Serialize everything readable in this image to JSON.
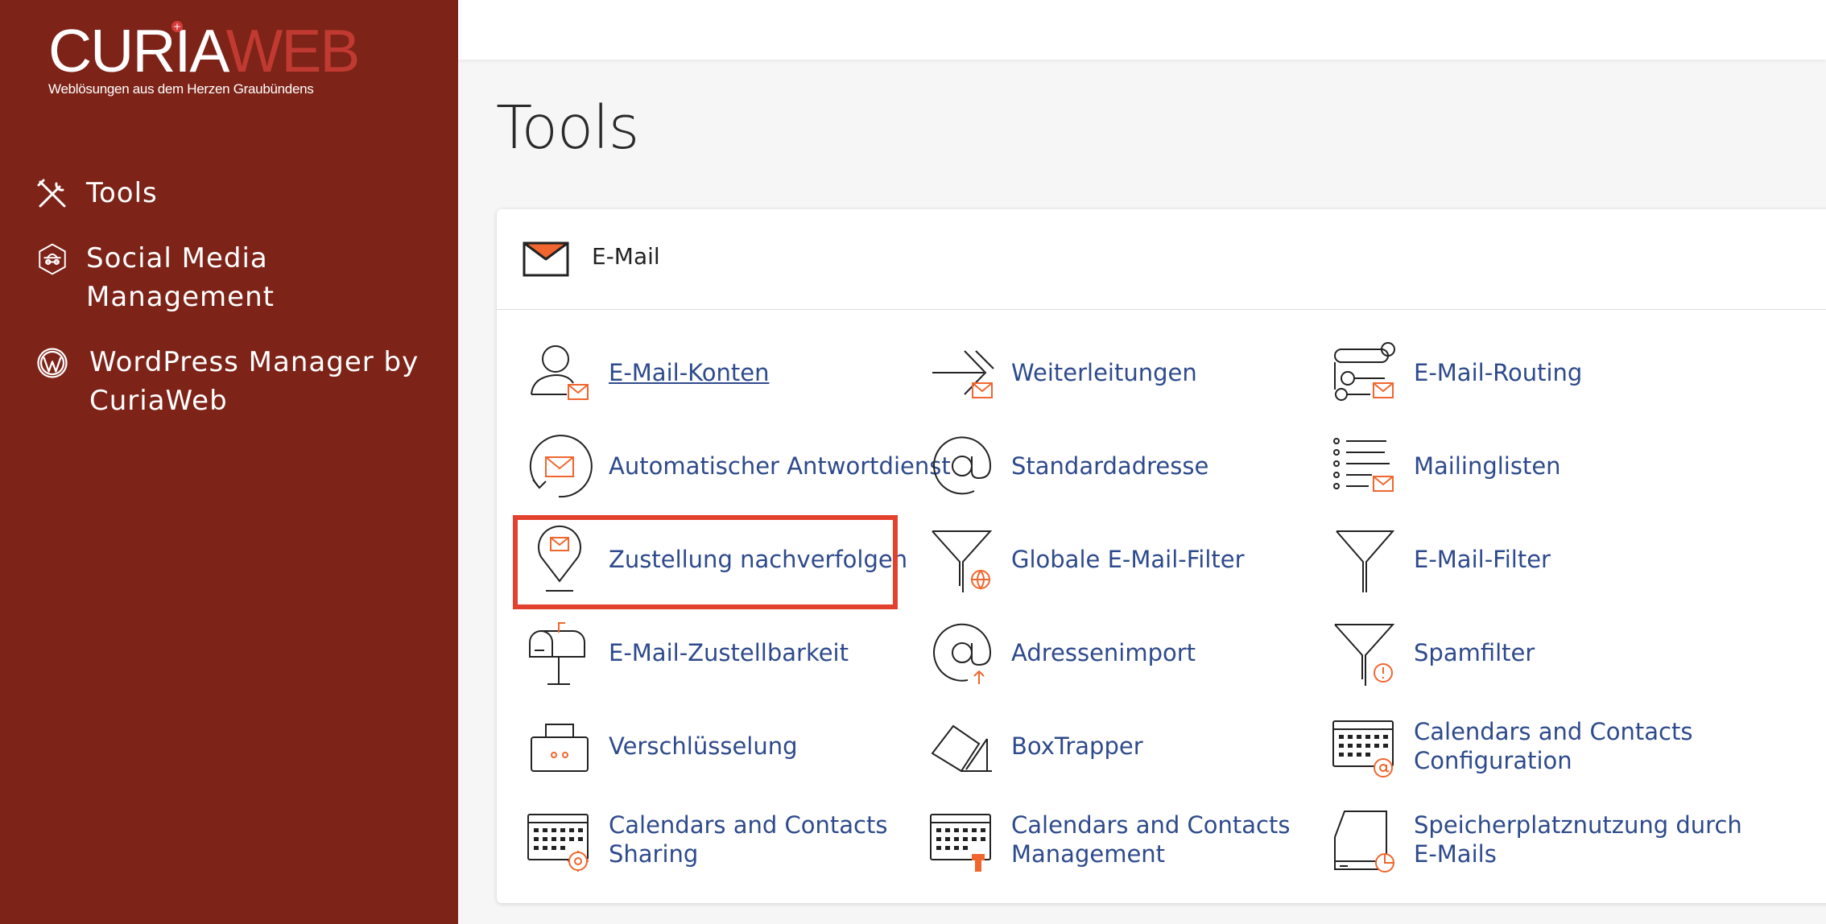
{
  "brand": {
    "logo_main": "CURIA",
    "logo_accent": "WEB",
    "tagline": "Weblösungen aus dem Herzen Graubündens",
    "star_glyph": "+"
  },
  "sidebar": {
    "items": [
      {
        "label": "Tools",
        "icon": "tools-icon"
      },
      {
        "label_line1": "Social Media",
        "label_line2": "Management",
        "icon": "social-media-icon"
      },
      {
        "label_line1": "WordPress Manager by",
        "label_line2": "CuriaWeb",
        "icon": "wordpress-icon"
      }
    ]
  },
  "page": {
    "title": "Tools"
  },
  "email_section": {
    "title": "E-Mail",
    "tools": [
      {
        "label": "E-Mail-Konten",
        "icon": "user-mail-icon"
      },
      {
        "label": "Weiterleitungen",
        "icon": "forward-arrow-icon"
      },
      {
        "label": "E-Mail-Routing",
        "icon": "routing-icon"
      },
      {
        "label": "Automatischer Antwortdienst",
        "icon": "autoresponder-icon"
      },
      {
        "label": "Standardadresse",
        "icon": "at-sign-icon"
      },
      {
        "label": "Mailinglisten",
        "icon": "mailing-list-icon"
      },
      {
        "label": "Zustellung nachverfolgen",
        "icon": "track-delivery-icon"
      },
      {
        "label": "Globale E-Mail-Filter",
        "icon": "global-filter-icon"
      },
      {
        "label": "E-Mail-Filter",
        "icon": "filter-icon"
      },
      {
        "label": "E-Mail-Zustellbarkeit",
        "icon": "mailbox-icon"
      },
      {
        "label": "Adressenimport",
        "icon": "address-import-icon"
      },
      {
        "label": "Spamfilter",
        "icon": "spam-filter-icon"
      },
      {
        "label": "Verschlüsselung",
        "icon": "encryption-icon"
      },
      {
        "label": "BoxTrapper",
        "icon": "boxtrapper-icon"
      },
      {
        "label_line1": "Calendars and Contacts",
        "label_line2": "Configuration",
        "icon": "calendar-config-icon"
      },
      {
        "label_line1": "Calendars and Contacts",
        "label_line2": "Sharing",
        "icon": "calendar-sharing-icon"
      },
      {
        "label_line1": "Calendars and Contacts",
        "label_line2": "Management",
        "icon": "calendar-management-icon"
      },
      {
        "label_line1": "Speicherplatznutzung durch",
        "label_line2": "E-Mails",
        "icon": "disk-usage-icon"
      }
    ]
  },
  "colors": {
    "sidebar_bg": "#7d2318",
    "link": "#2e4a8c",
    "accent_orange": "#f0662e",
    "highlight_border": "#e2412e"
  }
}
